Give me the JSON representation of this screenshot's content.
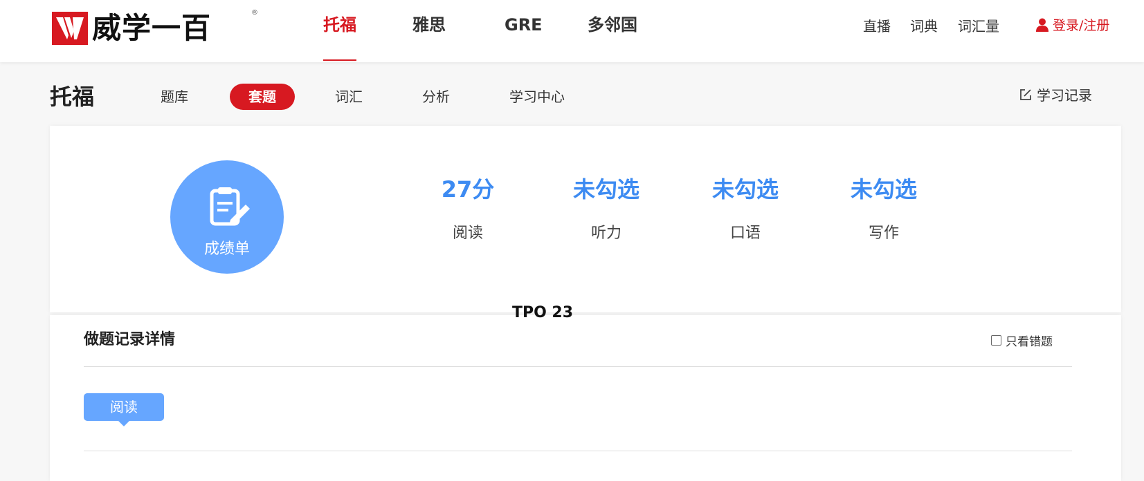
{
  "brand": {
    "name": "威学一百",
    "reg": "®"
  },
  "mainnav": {
    "items": [
      {
        "label": "托福",
        "active": true
      },
      {
        "label": "雅思",
        "active": false
      },
      {
        "label": "GRE",
        "active": false
      },
      {
        "label": "多邻国",
        "active": false
      }
    ]
  },
  "rightnav": {
    "items": [
      "直播",
      "词典",
      "词汇量"
    ],
    "login": "登录/注册"
  },
  "subheader": {
    "title": "托福",
    "tabs": [
      "题库",
      "套题",
      "词汇",
      "分析",
      "学习中心"
    ],
    "active_tab": "套题",
    "record_label": "学习记录"
  },
  "report": {
    "label": "成绩单",
    "stats": [
      {
        "value": "27分",
        "name": "阅读"
      },
      {
        "value": "未勾选",
        "name": "听力"
      },
      {
        "value": "未勾选",
        "name": "口语"
      },
      {
        "value": "未勾选",
        "name": "写作"
      }
    ],
    "test_name": "TPO 23"
  },
  "detail": {
    "title": "做题记录详情",
    "only_wrong_label": "只看错题",
    "only_wrong_checked": false,
    "section": "阅读"
  },
  "colors": {
    "brand_red": "#d71921",
    "accent_blue": "#3d8bf2",
    "light_blue": "#66a6ff"
  }
}
